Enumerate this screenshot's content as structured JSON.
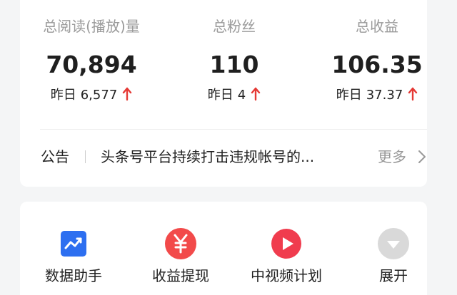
{
  "stats": [
    {
      "label": "总阅读(播放)量",
      "value": "70,894",
      "delta_prefix": "昨日",
      "delta_value": "6,577"
    },
    {
      "label": "总粉丝",
      "value": "110",
      "delta_prefix": "昨日",
      "delta_value": "4"
    },
    {
      "label": "总收益",
      "value": "106.35",
      "delta_prefix": "昨日",
      "delta_value": "37.37"
    }
  ],
  "delta_icon": "arrow-up-icon",
  "notice": {
    "title": "公告",
    "text": "头条号平台持续打击违规帐号的...",
    "more": "更多",
    "more_icon": "chevron-right-icon"
  },
  "tools": [
    {
      "label": "数据助手",
      "icon": "trend-chart-icon",
      "color": "#2d6ff0"
    },
    {
      "label": "收益提现",
      "icon": "yuan-icon",
      "color": "#f24a4a"
    },
    {
      "label": "中视频计划",
      "icon": "video-play-icon",
      "color": "#f03c4e"
    },
    {
      "label": "展开",
      "icon": "chevron-down-icon",
      "color": "#d9d9d9"
    }
  ],
  "colors": {
    "up_arrow": "#e53935",
    "background": "#f4f5f6",
    "card": "#ffffff"
  }
}
